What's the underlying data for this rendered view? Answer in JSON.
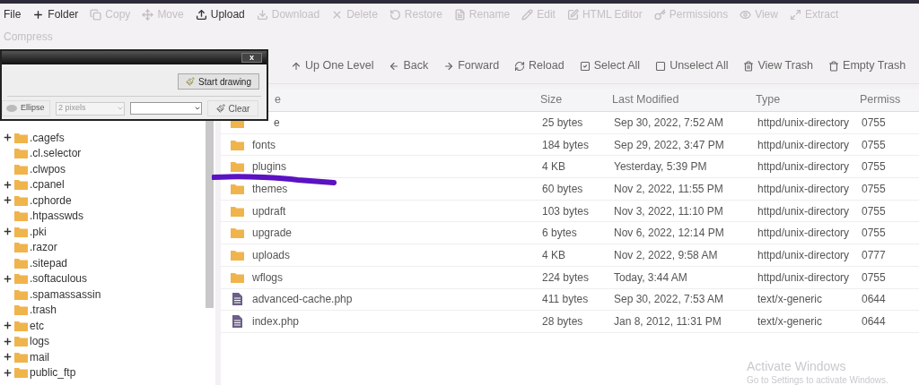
{
  "toolbar": [
    {
      "label": "File",
      "kind": "menu",
      "disabled": false
    },
    {
      "label": "Folder",
      "kind": "plus",
      "disabled": false
    },
    {
      "label": "Copy",
      "kind": "copy",
      "disabled": true
    },
    {
      "label": "Move",
      "kind": "move",
      "disabled": true
    },
    {
      "label": "Upload",
      "kind": "upload",
      "disabled": false
    },
    {
      "label": "Download",
      "kind": "download",
      "disabled": true
    },
    {
      "label": "Delete",
      "kind": "delete",
      "disabled": true
    },
    {
      "label": "Restore",
      "kind": "restore",
      "disabled": true
    },
    {
      "label": "Rename",
      "kind": "rename",
      "disabled": true
    },
    {
      "label": "Edit",
      "kind": "edit",
      "disabled": true
    },
    {
      "label": "HTML Editor",
      "kind": "html",
      "disabled": true
    },
    {
      "label": "Permissions",
      "kind": "key",
      "disabled": true
    },
    {
      "label": "View",
      "kind": "view",
      "disabled": true
    },
    {
      "label": "Extract",
      "kind": "extract",
      "disabled": true
    },
    {
      "label": "Compress",
      "kind": "menu",
      "disabled": true
    }
  ],
  "tree": [
    {
      "label": ".cagefs",
      "expandable": true
    },
    {
      "label": ".cl.selector",
      "expandable": false
    },
    {
      "label": ".clwpos",
      "expandable": false
    },
    {
      "label": ".cpanel",
      "expandable": true
    },
    {
      "label": ".cphorde",
      "expandable": true
    },
    {
      "label": ".htpasswds",
      "expandable": false
    },
    {
      "label": ".pki",
      "expandable": true
    },
    {
      "label": ".razor",
      "expandable": false
    },
    {
      "label": ".sitepad",
      "expandable": false
    },
    {
      "label": ".softaculous",
      "expandable": true
    },
    {
      "label": ".spamassassin",
      "expandable": false
    },
    {
      "label": ".trash",
      "expandable": false
    },
    {
      "label": "etc",
      "expandable": true
    },
    {
      "label": "logs",
      "expandable": true
    },
    {
      "label": "mail",
      "expandable": true
    },
    {
      "label": "public_ftp",
      "expandable": true
    }
  ],
  "nav": [
    {
      "label": "Up One Level",
      "kind": "up"
    },
    {
      "label": "Back",
      "kind": "back"
    },
    {
      "label": "Forward",
      "kind": "forward"
    },
    {
      "label": "Reload",
      "kind": "reload"
    },
    {
      "label": "Select All",
      "kind": "select"
    },
    {
      "label": "Unselect All",
      "kind": "unselect"
    },
    {
      "label": "View Trash",
      "kind": "trash"
    },
    {
      "label": "Empty Trash",
      "kind": "empty"
    }
  ],
  "table": {
    "columns": [
      "e",
      "Size",
      "Last Modified",
      "Type",
      "Permiss"
    ],
    "rows": [
      {
        "kind": "folder",
        "name": "e",
        "size": "25 bytes",
        "modified": "Sep 30, 2022, 7:52 AM",
        "type": "httpd/unix-directory",
        "perms": "0755"
      },
      {
        "kind": "folder",
        "name": "fonts",
        "size": "184 bytes",
        "modified": "Sep 29, 2022, 3:47 PM",
        "type": "httpd/unix-directory",
        "perms": "0755"
      },
      {
        "kind": "folder",
        "name": "plugins",
        "size": "4 KB",
        "modified": "Yesterday, 5:39 PM",
        "type": "httpd/unix-directory",
        "perms": "0755"
      },
      {
        "kind": "folder",
        "name": "themes",
        "size": "60 bytes",
        "modified": "Nov 2, 2022, 11:55 PM",
        "type": "httpd/unix-directory",
        "perms": "0755"
      },
      {
        "kind": "folder",
        "name": "updraft",
        "size": "103 bytes",
        "modified": "Nov 3, 2022, 11:10 PM",
        "type": "httpd/unix-directory",
        "perms": "0755"
      },
      {
        "kind": "folder",
        "name": "upgrade",
        "size": "6 bytes",
        "modified": "Nov 6, 2022, 12:14 PM",
        "type": "httpd/unix-directory",
        "perms": "0755"
      },
      {
        "kind": "folder",
        "name": "uploads",
        "size": "4 KB",
        "modified": "Nov 2, 2022, 9:58 AM",
        "type": "httpd/unix-directory",
        "perms": "0777"
      },
      {
        "kind": "folder",
        "name": "wflogs",
        "size": "224 bytes",
        "modified": "Today, 3:44 AM",
        "type": "httpd/unix-directory",
        "perms": "0755"
      },
      {
        "kind": "file",
        "name": "advanced-cache.php",
        "size": "411 bytes",
        "modified": "Sep 30, 2022, 7:53 AM",
        "type": "text/x-generic",
        "perms": "0644"
      },
      {
        "kind": "file",
        "name": "index.php",
        "size": "28 bytes",
        "modified": "Jan 8, 2012, 11:31 PM",
        "type": "text/x-generic",
        "perms": "0644"
      }
    ]
  },
  "drawing_tool": {
    "close": "x",
    "start": "Start drawing",
    "shape": "Ellipse",
    "width": "2 pixels",
    "clear": "Clear"
  },
  "activation": {
    "title": "Activate Windows",
    "hint": "Go to Settings to activate Windows."
  }
}
